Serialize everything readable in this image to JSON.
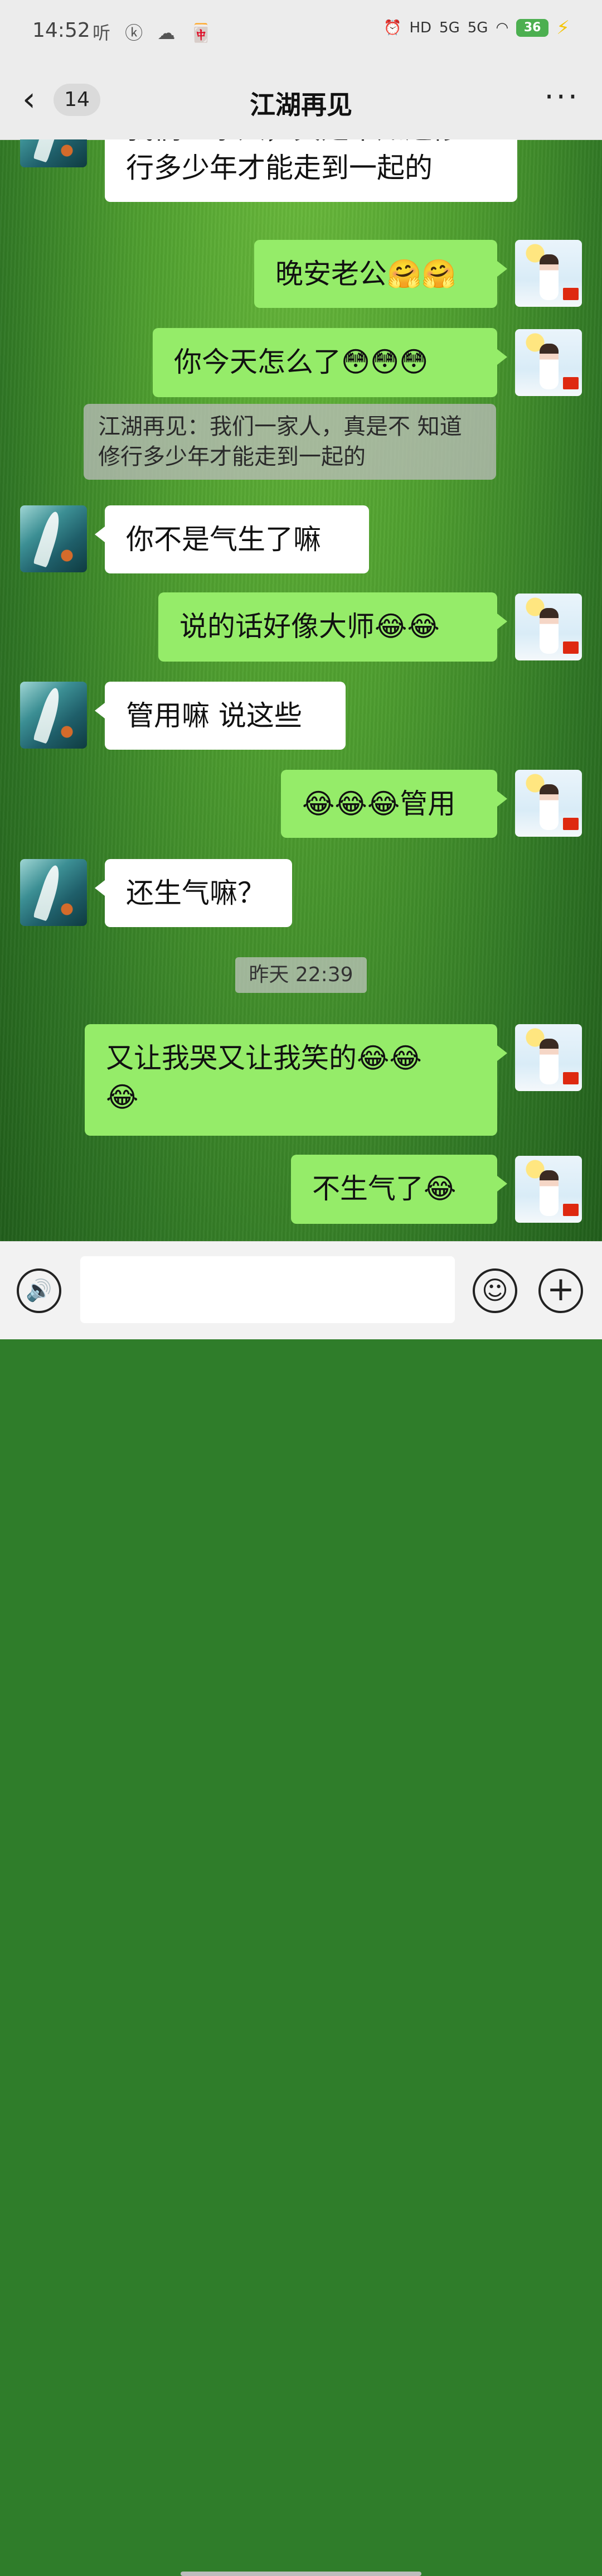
{
  "status_bar": {
    "time": "14:52",
    "left_icons": "听 ⓚ ☁ 🀄",
    "hd": "HD",
    "network1": "5G",
    "network2": "5G",
    "wifi": "wifi",
    "battery": "36",
    "charging": "⚡"
  },
  "header": {
    "back_icon": "‹",
    "unread_count": "14",
    "title": "江湖再见",
    "more_icon": "···"
  },
  "messages": [
    {
      "from": "them",
      "text": "我们一家人，真是不知道修\n行多少年才能走到一起的"
    },
    {
      "from": "me",
      "text": "晚安老公🤗🤗"
    },
    {
      "from": "me",
      "text": "你今天怎么了😳😳😳"
    },
    {
      "type": "quote",
      "text": "江湖再见：我们一家人，真是不\n知道修行多少年才能走到一起的"
    },
    {
      "from": "them",
      "text": "你不是气生了嘛"
    },
    {
      "from": "me",
      "text": "说的话好像大师😂😂"
    },
    {
      "from": "them",
      "text": "管用嘛 说这些"
    },
    {
      "from": "me",
      "text": "😂😂😂管用"
    },
    {
      "from": "them",
      "text": "还生气嘛？"
    },
    {
      "type": "timestamp",
      "text": "昨天 22:39"
    },
    {
      "from": "me",
      "text": "又让我哭又让我笑的😂😂\n😂"
    },
    {
      "from": "me",
      "text": "不生气了😂"
    }
  ],
  "input_bar": {
    "voice_icon": "🔊",
    "placeholder": "",
    "emoji_icon": "☺",
    "plus_icon": "+"
  },
  "colors": {
    "my_bubble": "#95ec69",
    "their_bubble": "#ffffff",
    "header_bg": "#ececec"
  }
}
